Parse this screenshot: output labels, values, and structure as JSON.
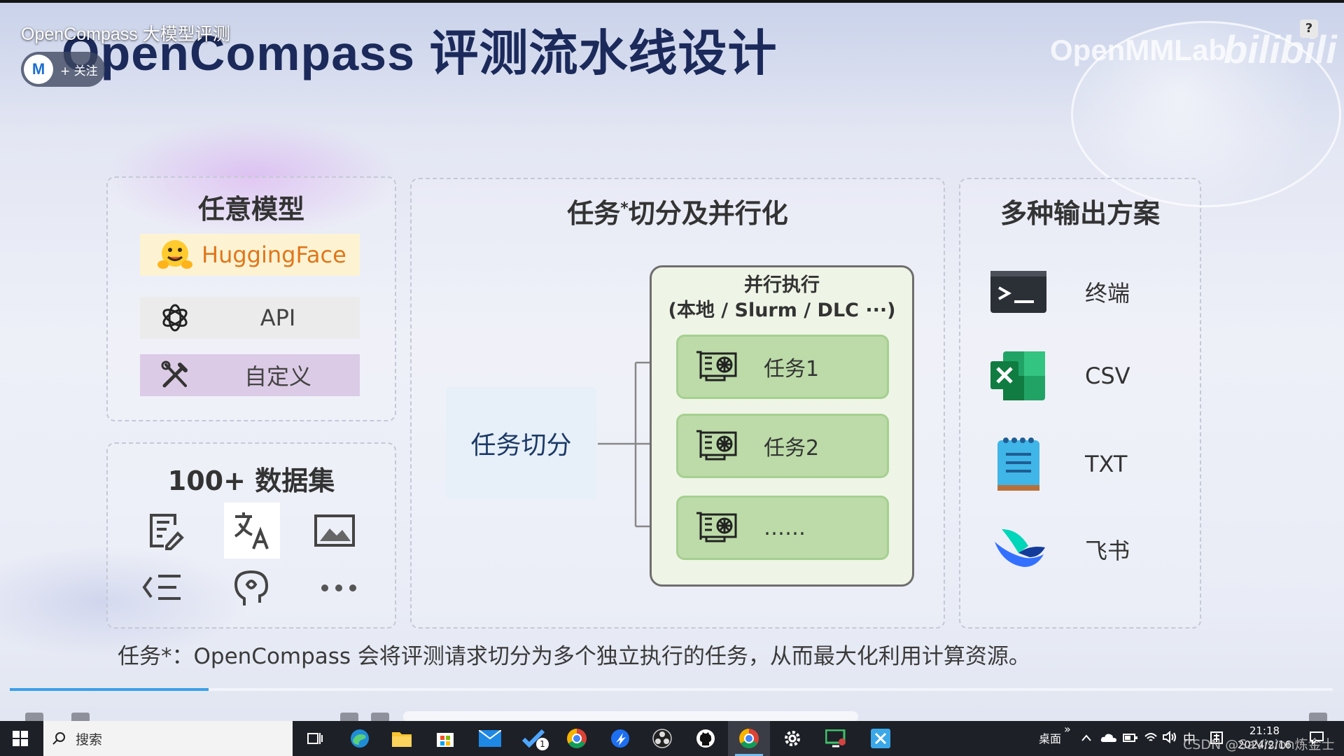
{
  "video": {
    "title": "OpenCompass 大模型评测",
    "follow_label": "+ 关注",
    "avatar_text": "M",
    "watermark": "OpenMMLab",
    "watermark_brand": "bilibili",
    "help_label": "?",
    "progress": 0.15
  },
  "slide": {
    "title": "OpenCompass 评测流水线设计",
    "models": {
      "title": "任意模型",
      "items": [
        {
          "label": "HuggingFace",
          "icon": "hugging-face-icon",
          "bg": "#fdf3d3",
          "color": "#e0761a"
        },
        {
          "label": "API",
          "icon": "openai-icon",
          "bg": "#eeeeee",
          "color": "#444444"
        },
        {
          "label": "自定义",
          "icon": "tools-icon",
          "bg": "#dccbe6",
          "color": "#444444"
        }
      ]
    },
    "datasets": {
      "title": "100+ 数据集",
      "icons": [
        "document-edit-icon",
        "translate-icon",
        "image-icon",
        "list-indent-icon",
        "brain-icon",
        "more-icon"
      ]
    },
    "pipeline": {
      "title": "任务",
      "title_mark": "*",
      "title_rest": "切分及并行化",
      "split_label": "任务切分",
      "exec_title_line1": "并行执行",
      "exec_title_line2": "(本地 / Slurm / DLC ···)",
      "tasks": [
        "任务1",
        "任务2",
        "……"
      ]
    },
    "outputs": {
      "title": "多种输出方案",
      "items": [
        {
          "label": "终端",
          "icon": "terminal-icon"
        },
        {
          "label": "CSV",
          "icon": "excel-icon"
        },
        {
          "label": "TXT",
          "icon": "notepad-icon"
        },
        {
          "label": "飞书",
          "icon": "feishu-icon"
        }
      ]
    },
    "footnote": "任务*：OpenCompass 会将评测请求切分为多个独立执行的任务，从而最大化利用计算资源。"
  },
  "taskbar": {
    "search_placeholder": "搜索",
    "apps": [
      "task-view-icon",
      "edge-icon",
      "file-explorer-icon",
      "store-icon",
      "mail-icon",
      "todo-icon",
      "chrome-icon",
      "feishu-app-icon",
      "obs-icon",
      "github-icon",
      "chrome-active-icon",
      "settings-icon",
      "remote-desktop-icon",
      "screenshot-icon"
    ],
    "todo_badge": "1",
    "desktop_label": "桌面",
    "expand_label": "»",
    "ime_label": "中",
    "time": "21:18",
    "date": "2024/2/16",
    "csdn_watermark": "CSDN @SaVision炼金士"
  }
}
